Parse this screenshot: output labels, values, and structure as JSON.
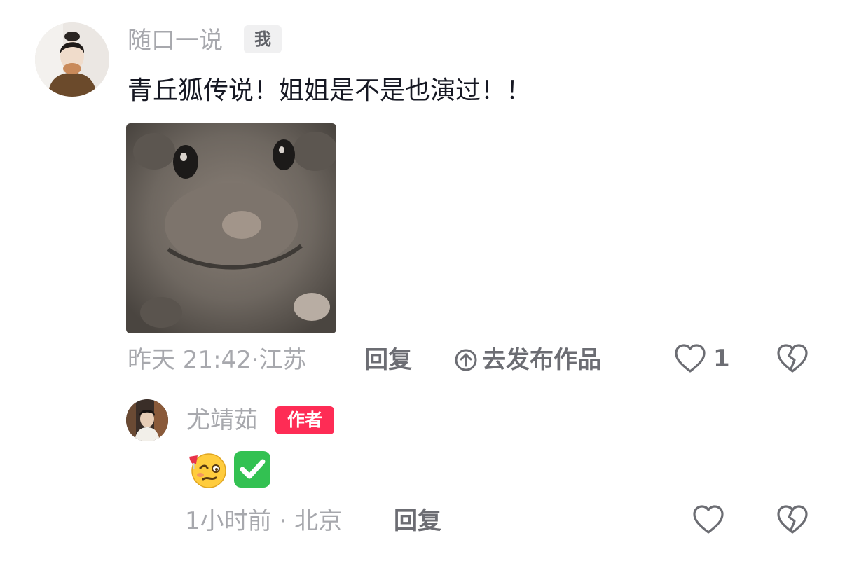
{
  "comment": {
    "username": "随口一说",
    "me_badge": "我",
    "text": "青丘狐传说！姐姐是不是也演过！！",
    "time": "昨天 21:42",
    "separator": "·",
    "location": "江苏",
    "reply_label": "回复",
    "publish_label": "去发布作品",
    "like_count": "1"
  },
  "reply": {
    "username": "尤靖茹",
    "author_badge": "作者",
    "emojis": [
      "🥴",
      "✅"
    ],
    "time": "1小时前",
    "separator": "·",
    "location": "北京",
    "reply_label": "回复"
  },
  "colors": {
    "author_badge_bg": "#fe2c55",
    "check_green": "#33c152",
    "meta_gray": "#a7a8ad"
  },
  "icons": {
    "like": "heart-outline-icon",
    "dislike": "broken-heart-icon",
    "publish": "upload-arrow-icon"
  }
}
